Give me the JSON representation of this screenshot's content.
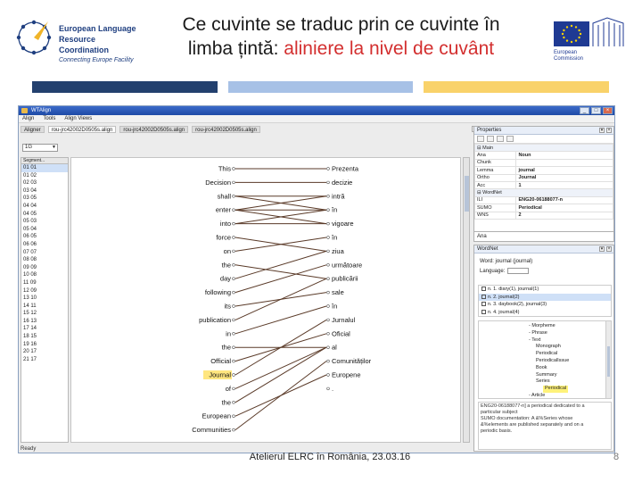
{
  "slide": {
    "title_line1": "Ce cuvinte se traduc prin ce cuvinte în",
    "title_line2_plain": "limba țintă: ",
    "title_line2_accent": "aliniere la nivel de cuvânt",
    "footer": "Atelierul ELRC în România, 23.03.16",
    "page_number": "8",
    "accent_color": "#d32f2f"
  },
  "logo_elrc": {
    "line1": "European Language",
    "line2": "Resource Coordination",
    "tagline": "Connecting Europe Facility"
  },
  "logo_ec": {
    "caption_line1": "European",
    "caption_line2": "Commission"
  },
  "app": {
    "window_title": "WTAlign",
    "menu": [
      "Align",
      "Tools",
      "Align Views"
    ],
    "tabs": [
      "Aligner",
      "rou-jrc42002D0505s.align",
      "rou-jrc42002D0505s.align",
      "rou-jrc42002D0505s.align"
    ],
    "segment_select": "1G",
    "segment_header": "Segment...",
    "segments": [
      "01 01",
      "01 02",
      "02 03",
      "03 04",
      "03 05",
      "04 04",
      "04 05",
      "05 03",
      "05 04",
      "06 05",
      "06 06",
      "07 07",
      "08 08",
      "09 09",
      "10 08",
      "11 09",
      "12 09",
      "13 10",
      "14 11",
      "15 12",
      "16 13",
      "17 14",
      "18 15",
      "19 16",
      "20 17",
      "21 17"
    ],
    "status": "Ready",
    "source_words": [
      "This",
      "Decision",
      "shall",
      "enter",
      "into",
      "force",
      "on",
      "the",
      "day",
      "following",
      "its",
      "publication",
      "in",
      "the",
      "Official",
      "Journal",
      "of",
      "the",
      "European",
      "Communities"
    ],
    "target_words": [
      "Prezenta",
      "decizie",
      "intră",
      "în",
      "vigoare",
      "în",
      "ziua",
      "următoare",
      "publicării",
      "sale",
      "în",
      "Jurnalul",
      "Oficial",
      "al",
      "Comunităților",
      "Europene",
      "."
    ],
    "highlighted_source": "Journal",
    "highlight_color": "#ffe680",
    "link_color": "#5a3a28"
  },
  "properties": {
    "header": "Properties",
    "groups": [
      {
        "name": "Main",
        "rows": [
          [
            "Ana",
            "Noun"
          ],
          [
            "Chunk",
            ""
          ],
          [
            "Lemma",
            "journal"
          ],
          [
            "Ortho",
            "Journal"
          ],
          [
            "Acc",
            "1"
          ]
        ]
      },
      {
        "name": "WordNet",
        "rows": [
          [
            "ILI",
            "ENG20-06188077-n"
          ],
          [
            "SUMO",
            "Periodical"
          ],
          [
            "WNS",
            "2"
          ]
        ]
      }
    ]
  },
  "ana_label": "Ana",
  "wordnet": {
    "header": "WordNet",
    "word_label": "Word: journal (journal)",
    "language_label": "Language:",
    "senses": [
      "n. 1. diary(1), journal(1)",
      "n. 2. journal(2)",
      "n. 3. daybook(2), journal(3)",
      "n. 4. journal(4)"
    ],
    "tree": [
      "Morpheme",
      "Phrase",
      "Text",
      "Monograph",
      "Periodical",
      "PeriodicalIssue",
      "Book",
      "Summary",
      "Series",
      "Periodical",
      "Article"
    ],
    "tree_highlighted": "Periodical",
    "gloss_lines": [
      "ENG20-06188077-n] a periodical dedicated to a",
      "particular subject",
      "SUMO documentation: A &%Series whose",
      "&%elements are published separately and on a",
      "periodic basis."
    ]
  }
}
